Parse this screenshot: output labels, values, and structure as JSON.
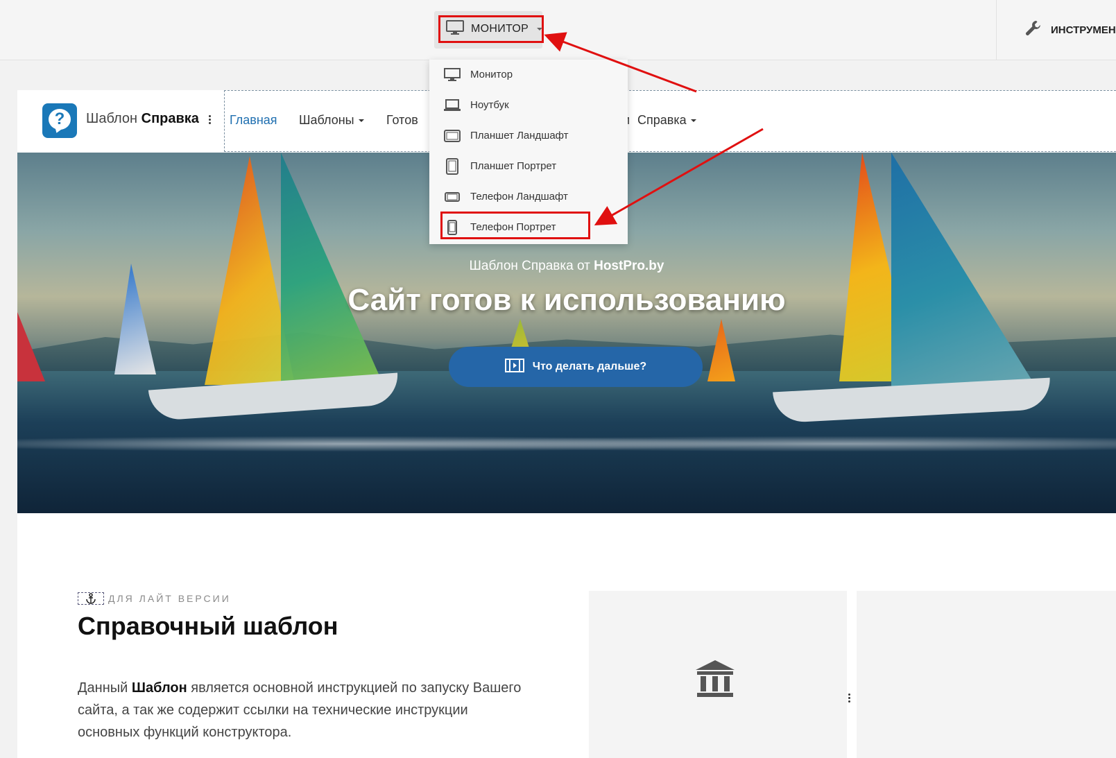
{
  "toolbar": {
    "device_label": "МОНИТОР",
    "tools_label": "ИНСТРУМЕН"
  },
  "device_menu": {
    "items": [
      {
        "label": "Монитор",
        "icon": "monitor-icon"
      },
      {
        "label": "Ноутбук",
        "icon": "laptop-icon"
      },
      {
        "label": "Планшет Ландшафт",
        "icon": "tablet-landscape-icon"
      },
      {
        "label": "Планшет Портрет",
        "icon": "tablet-portrait-icon"
      },
      {
        "label": "Телефон Ландшафт",
        "icon": "phone-landscape-icon"
      },
      {
        "label": "Телефон Портрет",
        "icon": "phone-portrait-icon"
      }
    ],
    "highlighted": "Телефон Портрет"
  },
  "site": {
    "brand_light": "Шаблон",
    "brand_bold": "Справка",
    "nav": [
      {
        "label": "Главная",
        "active": true,
        "dropdown": false
      },
      {
        "label": "Шаблоны",
        "active": false,
        "dropdown": true
      },
      {
        "label": "Готов",
        "active": false,
        "dropdown": false
      },
      {
        "label": "и",
        "active": false,
        "dropdown": false
      },
      {
        "label": "Справка",
        "active": false,
        "dropdown": true
      }
    ]
  },
  "hero": {
    "subtitle_prefix": "Шаблон Справка от",
    "subtitle_brand": "HostPro.by",
    "title": "Сайт готов к использованию",
    "cta_label": "Что делать дальше?"
  },
  "content": {
    "eyebrow": "ДЛЯ ЛАЙТ ВЕРСИИ",
    "heading": "Справочный шаблон",
    "para_prefix": "Данный",
    "para_bold": "Шаблон",
    "para_rest": "является основной инструкцией по запуску Вашего сайта, а так же содержит ссылки на технические инструкции основных функций конструктора."
  },
  "colors": {
    "accent": "#1f6fb0",
    "cta": "#2566a8",
    "highlight": "#e01010"
  }
}
